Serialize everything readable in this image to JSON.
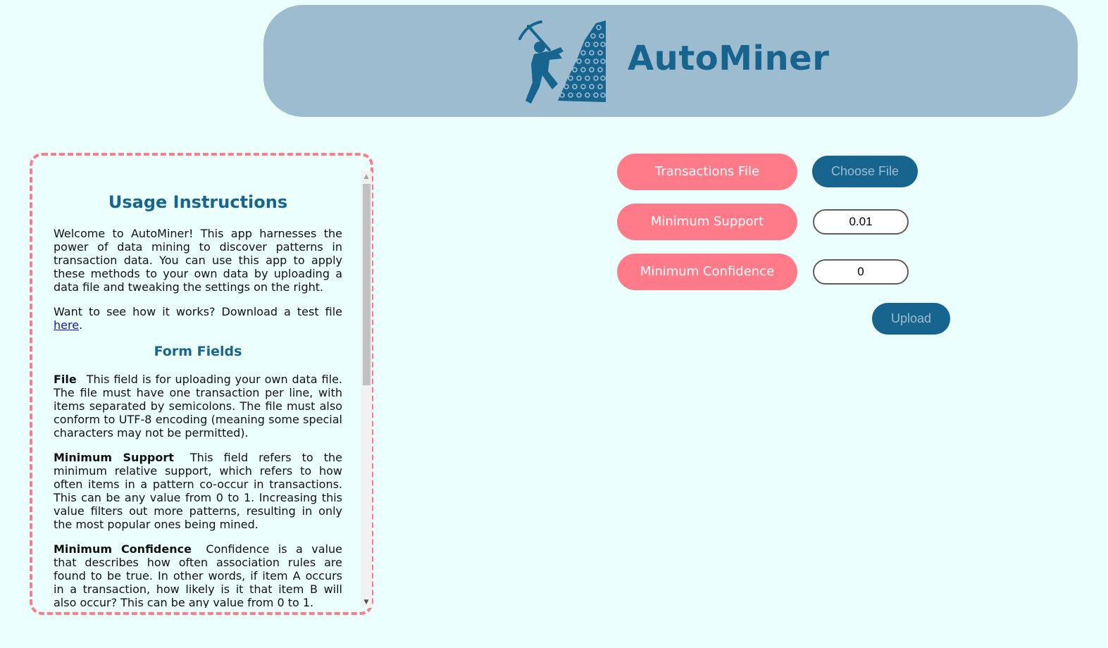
{
  "header": {
    "title": "AutoMiner",
    "logo_icon": "miner-logo-icon"
  },
  "instructions": {
    "title": "Usage Instructions",
    "intro": "Welcome to AutoMiner! This app harnesses the power of data mining to discover patterns in transaction data. You can use this app to apply these methods to your own data by uploading a data file and tweaking the settings on the right.",
    "test_file_text": "Want to see how it works? Download a test file",
    "test_file_link": "here",
    "test_file_end": ".",
    "form_fields_heading": "Form Fields",
    "fields": [
      {
        "name": "File",
        "description": "This field is for uploading your own data file. The file must have one transaction per line, with items separated by semicolons. The file must also conform to UTF-8 encoding (meaning some special characters may not be permitted)."
      },
      {
        "name": "Minimum Support",
        "description": "This field refers to the minimum relative support, which refers to how often items in a pattern co-occur in transactions. This can be any value from 0 to 1. Increasing this value filters out more patterns, resulting in only the most popular ones being mined."
      },
      {
        "name": "Minimum Confidence",
        "description": "Confidence is a value that describes how often association rules are found to be true. In other words, if item A occurs in a transaction, how likely is it that item B will also occur? This can be any value from 0 to 1."
      }
    ]
  },
  "form": {
    "transactions_label": "Transactions File",
    "choose_file_label": "Choose File",
    "min_support_label": "Minimum Support",
    "min_support_value": "0.01",
    "min_confidence_label": "Minimum Confidence",
    "min_confidence_value": "0",
    "upload_label": "Upload"
  },
  "colors": {
    "background": "#ebfffd",
    "header_bg": "#9ebccf",
    "accent_blue": "#17658f",
    "accent_pink": "#ff7b89"
  }
}
